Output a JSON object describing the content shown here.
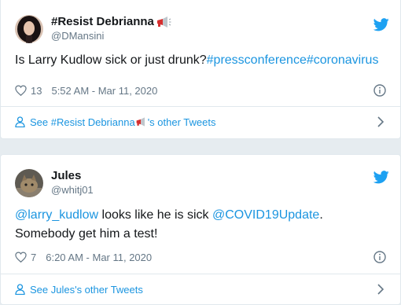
{
  "tweets": [
    {
      "display_name": "#Resist Debrianna",
      "screen_name": "@DMansini",
      "text_plain": "Is Larry Kudlow sick or just drunk?",
      "hashtags": [
        "#pressconference",
        "#coronavirus"
      ],
      "likes": "13",
      "timestamp": "5:52 AM - Mar 11, 2020",
      "see_more_prefix": "See #Resist Debrianna",
      "see_more_suffix": "'s other Tweets"
    },
    {
      "display_name": "Jules",
      "screen_name": "@whitj01",
      "mention1": "@larry_kudlow",
      "text_mid": " looks like he is sick ",
      "mention2": "@COVID19Update",
      "text_end": ". Somebody get him a test!",
      "likes": "7",
      "timestamp": "6:20 AM - Mar 11, 2020",
      "see_more": "See Jules's other Tweets"
    }
  ],
  "colors": {
    "link": "#1b95e0",
    "muted": "#657786",
    "text": "#14171a",
    "border": "#e1e8ed",
    "background": "#e6ecf0"
  },
  "icons": [
    "twitter-bird-icon",
    "heart-icon",
    "info-icon",
    "person-icon",
    "chevron-right-icon",
    "megaphone-icon"
  ]
}
